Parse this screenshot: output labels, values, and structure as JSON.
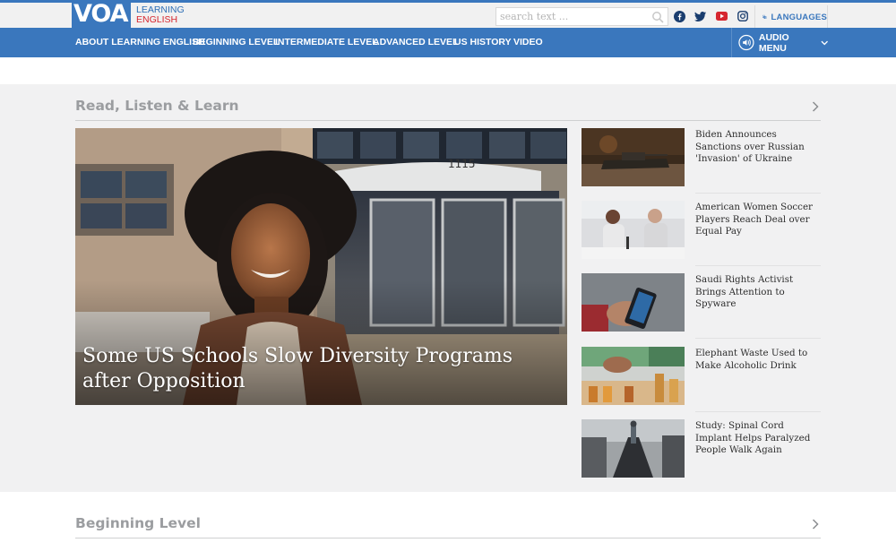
{
  "header": {
    "logo_mark": "VOA",
    "logo_line1": "LEARNING",
    "logo_line2": "ENGLISH",
    "search_placeholder": "search text ...",
    "languages_label": "LANGUAGES"
  },
  "nav": {
    "items": [
      "ABOUT LEARNING ENGLISH",
      "BEGINNING LEVEL",
      "INTERMEDIATE LEVEL",
      "ADVANCED LEVEL",
      "US HISTORY",
      "VIDEO"
    ],
    "audio_menu": "AUDIO MENU"
  },
  "featured": {
    "section_title": "Read, Listen & Learn",
    "hero_title": "Some US Schools Slow Diversity Programs after Opposition",
    "stories": [
      {
        "title": "Biden Announces Sanctions over Russian 'Invasion' of Ukraine"
      },
      {
        "title": "American Women Soccer Players Reach Deal over Equal Pay"
      },
      {
        "title": "Saudi Rights Activist Brings Attention to Spyware"
      },
      {
        "title": "Elephant Waste Used to Make Alcoholic Drink"
      },
      {
        "title": "Study: Spinal Cord Implant Helps Paralyzed People Walk Again"
      }
    ]
  },
  "beginning": {
    "section_title": "Beginning Level"
  },
  "colors": {
    "brand_blue": "#3a77bd",
    "brand_red": "#d6262f",
    "section_bg": "#f1f1f2",
    "section_title": "#9b9da0"
  },
  "icons": {
    "search": "search-icon",
    "facebook": "facebook-icon",
    "twitter": "twitter-icon",
    "youtube": "youtube-icon",
    "instagram": "instagram-icon",
    "languages": "languages-icon",
    "audio": "audio-icon",
    "chevron_down": "chevron-down-icon",
    "chevron_right": "chevron-right-icon"
  }
}
